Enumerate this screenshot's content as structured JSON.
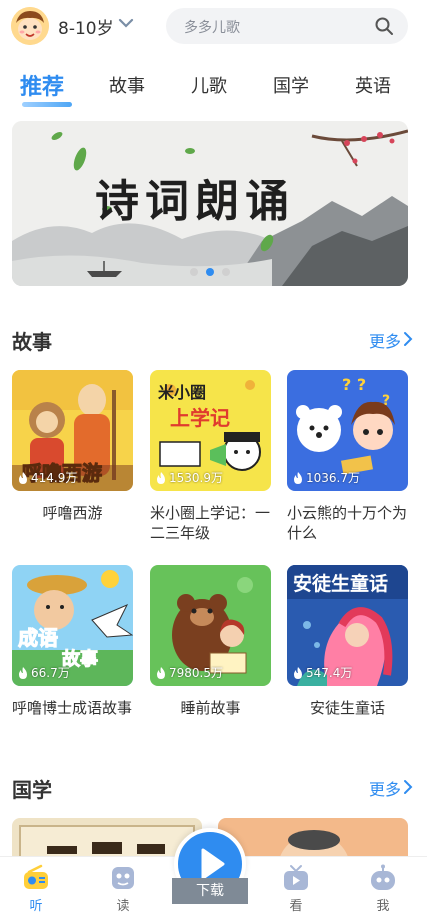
{
  "header": {
    "age_label": "8-10岁",
    "search_placeholder": "多多儿歌"
  },
  "tabs": [
    {
      "label": "推荐",
      "active": true
    },
    {
      "label": "故事"
    },
    {
      "label": "儿歌"
    },
    {
      "label": "国学"
    },
    {
      "label": "英语"
    }
  ],
  "banner": {
    "title": "诗词朗诵",
    "slides": 3,
    "active_slide": 2
  },
  "stories": {
    "title": "故事",
    "more": "更多",
    "items": [
      {
        "title": "呼噜西游",
        "plays": "414.9万"
      },
      {
        "title": "米小圈上学记：一二三年级",
        "plays": "1530.9万"
      },
      {
        "title": "小云熊的十万个为什么",
        "plays": "1036.7万"
      },
      {
        "title": "呼噜博士成语故事",
        "plays": "66.7万"
      },
      {
        "title": "睡前故事",
        "plays": "7980.5万"
      },
      {
        "title": "安徒生童话",
        "plays": "547.4万"
      }
    ]
  },
  "guoxue": {
    "title": "国学",
    "more": "更多"
  },
  "tabbar": {
    "items": [
      {
        "label": "听",
        "icon": "radio-icon",
        "active": true
      },
      {
        "label": "读",
        "icon": "robot-book-icon"
      },
      {
        "label": "看",
        "icon": "tv-icon"
      },
      {
        "label": "我",
        "icon": "robot-face-icon"
      }
    ],
    "download_label": "下载"
  },
  "colors": {
    "accent": "#2f8cf0"
  }
}
